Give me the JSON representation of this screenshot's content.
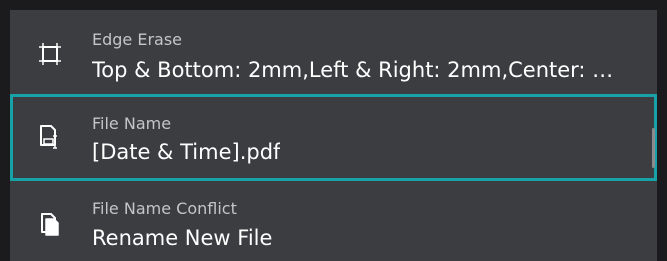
{
  "settings": {
    "items": [
      {
        "icon": "edge-erase-icon",
        "title": "Edge Erase",
        "value": "Top & Bottom: 2mm,Left & Right: 2mm,Center: …"
      },
      {
        "icon": "file-name-icon",
        "title": "File Name",
        "value": "[Date & Time].pdf",
        "selected": true
      },
      {
        "icon": "file-name-conflict-icon",
        "title": "File Name Conflict",
        "value": "Rename New File"
      }
    ]
  },
  "colors": {
    "background": "#3c3d41",
    "selection_border": "#16a2a6",
    "title_text": "#c4c5c9",
    "value_text": "#ffffff"
  }
}
